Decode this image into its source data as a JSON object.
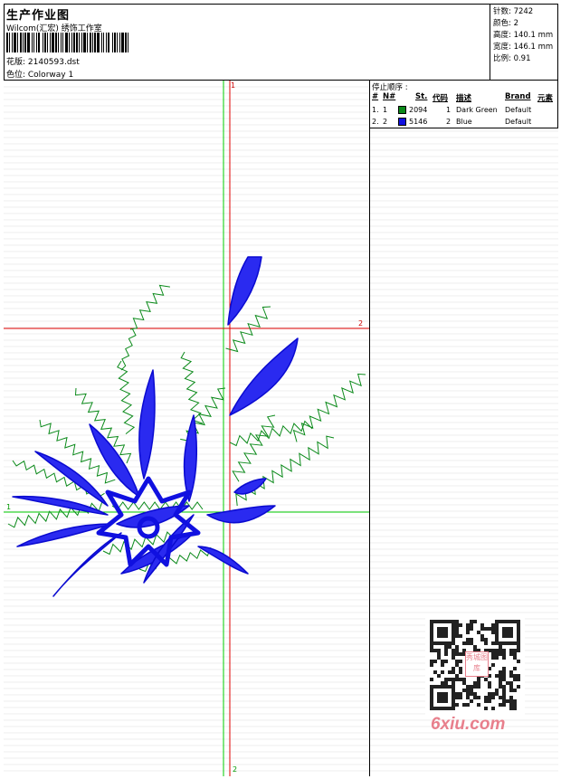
{
  "header": {
    "title": "生产作业图",
    "studio": "Wilcom(汇宏) 绣饰工作室",
    "file_label": "花版: 2140593.dst",
    "colorway_label": "色位: Colorway 1"
  },
  "stats": {
    "stitches": "针数: 7242",
    "colors": "颜色: 2",
    "height": "高度: 140.1 mm",
    "width": "宽度: 146.1 mm",
    "ratio": "比例: 0.91"
  },
  "stop_sequence": {
    "title": "停止顺序 :",
    "columns": {
      "hash": "#",
      "n": "N#",
      "st": "St.",
      "code": "代码",
      "desc": "描述",
      "brand": "Brand",
      "elem": "元素"
    },
    "rows": [
      {
        "hash": "1.",
        "n": "1",
        "color": "#0b8a1a",
        "st": "2094",
        "code": "1",
        "desc": "Dark Green",
        "brand": "Default"
      },
      {
        "hash": "2.",
        "n": "2",
        "color": "#1010e0",
        "st": "5146",
        "code": "2",
        "desc": "Blue",
        "brand": "Default"
      }
    ]
  },
  "axis_labels": {
    "top": "1",
    "right": "2",
    "left": "1",
    "bottom": "2"
  },
  "watermark": {
    "text": "6xiu.com",
    "qr_badge": "秀城图库"
  },
  "colors": {
    "green_thread": "#0b8a1a",
    "blue_thread": "#1010e0",
    "red_axis": "#e00000",
    "green_axis": "#00cc00"
  }
}
